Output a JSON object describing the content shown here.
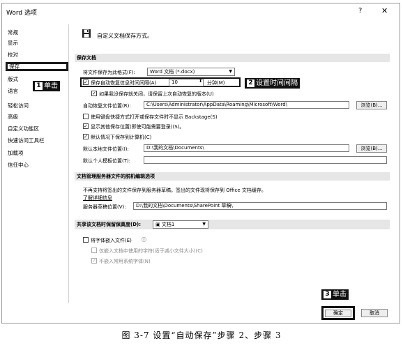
{
  "window": {
    "title": "Word 选项",
    "help": "?",
    "close": "✕"
  },
  "sidebar": {
    "items": [
      {
        "label": "常规"
      },
      {
        "label": "显示"
      },
      {
        "label": "校对"
      },
      {
        "label": "保存"
      },
      {
        "label": "版式"
      },
      {
        "label": "语言"
      },
      {
        "label": "轻松访问"
      },
      {
        "label": "高级"
      },
      {
        "label": "自定义功能区"
      },
      {
        "label": "快速访问工具栏"
      },
      {
        "label": "加载项"
      },
      {
        "label": "信任中心"
      }
    ],
    "selected_index": 3
  },
  "callouts": {
    "c1": {
      "num": "1",
      "text": "单击"
    },
    "c2": {
      "num": "2",
      "text": "设置时间间隔"
    },
    "c3": {
      "num": "3",
      "text": "单击"
    }
  },
  "main": {
    "header": "自定义文档保存方式。",
    "save_docs": {
      "section": "保存文档",
      "format_label": "将文件保存为此格式(F):",
      "format_value": "Word 文档 (*.docx)",
      "autorecover_label": "保存自动恢复信息时间间隔(A)",
      "autorecover_checked": "✓",
      "autorecover_value": "10",
      "autorecover_unit": "分钟(M)",
      "keep_last_label": "如果我没保存就关闭，请保留上次自动恢复的版本(U)",
      "keep_last_checked": "✓",
      "autorecover_loc_label": "自动恢复文件位置(R):",
      "autorecover_loc_value": "C:\\Users\\Administrator\\AppData\\Roaming\\Microsoft\\Word\\",
      "browse_label": "浏览(B)...",
      "no_backstage_label": "使用键盘快捷方式打开或保存文件时不显示 Backstage(S)",
      "no_backstage_checked": "",
      "show_additional_label": "显示其他保存位置(即使可能需要登录)(S)。",
      "show_additional_checked": "✓",
      "save_to_pc_label": "默认情况下保存到计算机(C)",
      "save_to_pc_checked": "✓",
      "local_loc_label": "默认本地文件位置(I):",
      "local_loc_value": "D:\\我的文档\\Documents\\",
      "browse2_label": "浏览(B)...",
      "personal_templates_label": "默认个人模板位置(T):",
      "personal_templates_value": ""
    },
    "offline": {
      "section": "文档管理服务器文件的脱机编辑选项",
      "note": "不再支持将签出的文件保存到服务器草稿。签出的文件现将保存到 Office 文档缓存。",
      "learn_more": "了解详细信息",
      "drafts_label": "服务器草稿位置(V):",
      "drafts_value": "D:\\我的文档\\Documents\\SharePoint 草稿\\"
    },
    "fidelity": {
      "section": "共享该文档时保留保真度(D):",
      "doc_value": "文档1",
      "embed_fonts_label": "将字体嵌入文件(E)",
      "embed_fonts_info": "ⓘ",
      "embed_used_label": "仅嵌入文档中使用的字符(适于减小文件大小)(C)",
      "no_common_label": "不嵌入常用系统字体(N)",
      "no_common_checked": "✓"
    }
  },
  "footer": {
    "ok": "确定",
    "cancel": "取消"
  },
  "caption": "图 3-7   设置“自动保存”步骤 2、步骤 3"
}
